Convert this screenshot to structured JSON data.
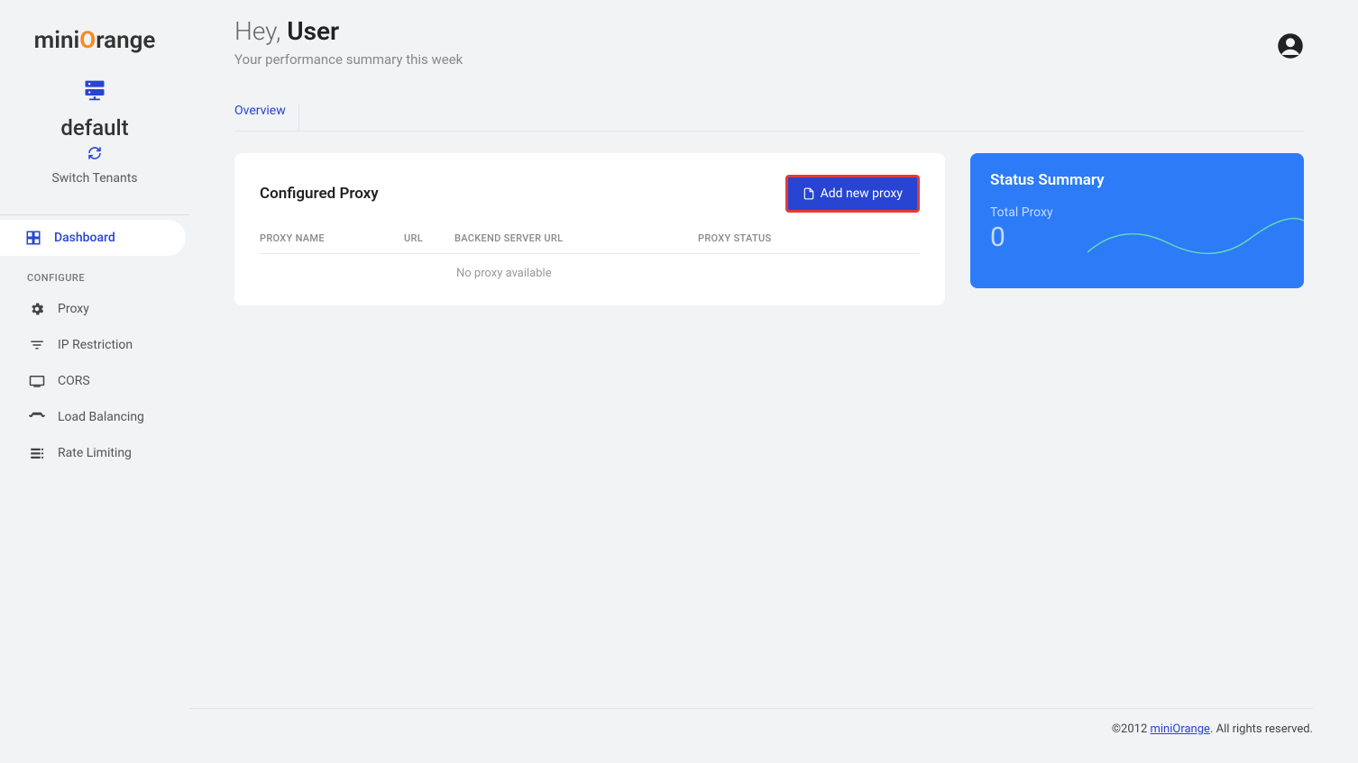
{
  "brand": {
    "name_pre": "mini",
    "name_accent": "O",
    "name_post": "range"
  },
  "tenant": {
    "name": "default",
    "switch_label": "Switch Tenants"
  },
  "sidebar": {
    "dashboard_label": "Dashboard",
    "section_label": "CONFIGURE",
    "items": [
      {
        "label": "Proxy"
      },
      {
        "label": "IP Restriction"
      },
      {
        "label": "CORS"
      },
      {
        "label": "Load Balancing"
      },
      {
        "label": "Rate Limiting"
      }
    ]
  },
  "header": {
    "greeting_pre": "Hey, ",
    "user_name": "User",
    "subtext": "Your performance summary this week"
  },
  "tabs": {
    "overview": "Overview"
  },
  "proxy_card": {
    "title": "Configured Proxy",
    "add_label": "Add new proxy",
    "columns": {
      "name": "PROXY NAME",
      "url": "URL",
      "backend": "BACKEND SERVER URL",
      "status": "PROXY STATUS"
    },
    "empty": "No proxy available"
  },
  "summary": {
    "title": "Status Summary",
    "label": "Total Proxy",
    "count": "0"
  },
  "footer": {
    "copyright_pre": "©2012 ",
    "link": "miniOrange",
    "copyright_post": ". All rights reserved."
  }
}
